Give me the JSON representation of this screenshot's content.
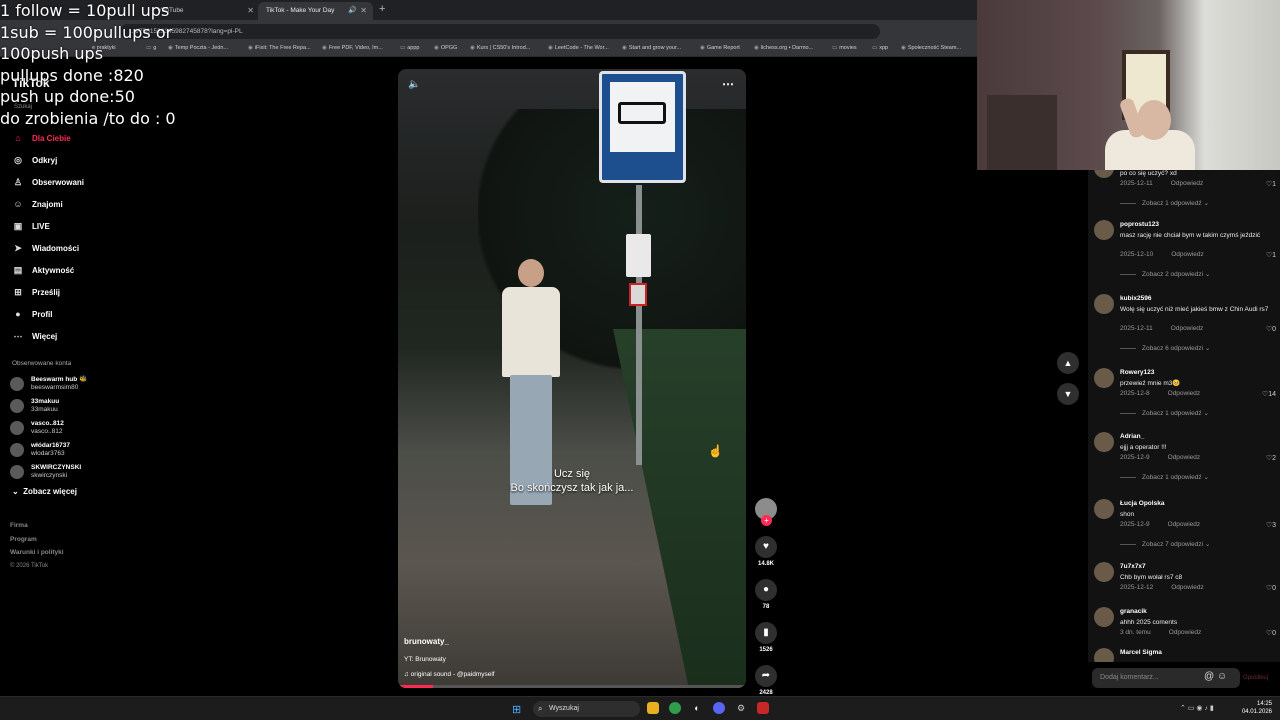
{
  "browser": {
    "tabs": [
      {
        "label": "YouTube",
        "active": false
      },
      {
        "label": "TikTok - Make Your Day",
        "active": true
      }
    ],
    "url": "...t/7581529345982745878?lang=pl-PL",
    "bookmarks": [
      "e praktyki",
      "g",
      "Temp Poczta - Jedn...",
      "iFixit: The Free Repa...",
      "Free PDF, Video, Im...",
      "appp",
      "OPGG",
      "Kurs | CS50's Introd...",
      "LeetCode - The Wor...",
      "Start and grow your...",
      "Game Report",
      "lichess.org • Darmo...",
      "movies",
      "xpp",
      "Społeczność Steam..."
    ]
  },
  "overlay_lines": [
    "1 follow = 10pull ups",
    "1sub = 100pullups or",
    "100push ups",
    "pullups done :820",
    "push up done:50",
    "do zrobienia /to do : 0"
  ],
  "sidebar": {
    "logo": "TikTok",
    "search_hint": "Szukaj",
    "nav": [
      {
        "icon": "home-icon",
        "glyph": "⌂",
        "label": "Dla Ciebie",
        "active": true
      },
      {
        "icon": "compass-icon",
        "glyph": "◎",
        "label": "Odkryj"
      },
      {
        "icon": "user-icon",
        "glyph": "♙",
        "label": "Obserwowani"
      },
      {
        "icon": "friends-icon",
        "glyph": "☺",
        "label": "Znajomi"
      },
      {
        "icon": "live-icon",
        "glyph": "▣",
        "label": "LIVE"
      },
      {
        "icon": "send-icon",
        "glyph": "➤",
        "label": "Wiadomości"
      },
      {
        "icon": "activity-icon",
        "glyph": "▤",
        "label": "Aktywność"
      },
      {
        "icon": "upload-icon",
        "glyph": "⊞",
        "label": "Prześlij"
      },
      {
        "icon": "profile-icon",
        "glyph": "●",
        "label": "Profil"
      },
      {
        "icon": "more-icon",
        "glyph": "⋯",
        "label": "Więcej"
      }
    ],
    "following_title": "Obserwowane konta",
    "accounts": [
      {
        "name": "Beeswarm hub 🐝",
        "user": "beeswarmsim80"
      },
      {
        "name": "33makuu",
        "user": "33makuu"
      },
      {
        "name": "vasco..812",
        "user": "vasco..812"
      },
      {
        "name": "włódar16737",
        "user": "wlodar3763"
      },
      {
        "name": "SKWIRCZYNSKI",
        "user": "skwirczynski"
      }
    ],
    "see_more": "Zobacz więcej",
    "footer": [
      "Firma",
      "Program",
      "Warunki i polityki"
    ],
    "copyright": "© 2026 TikTok"
  },
  "video": {
    "caption_line1": "Ucz się",
    "caption_line2": "Bo skończysz tak jak ja...",
    "author": "brunowaty_",
    "description": "YT: Brunowaty",
    "sound": "♫  original sound - @paidmyself",
    "progress": 0.1,
    "actions": {
      "likes": "14.8K",
      "comments": "78",
      "saves": "1526",
      "shares": "2428"
    }
  },
  "comments": [
    {
      "user": "",
      "text": "po co się uczyć? xd",
      "date": "2025-12-11",
      "reply": "Odpowiedz",
      "likes": "1",
      "replies": "Zobacz 1 odpowiedź"
    },
    {
      "user": "poprostu123",
      "text": "masz rację nie chciał bym w takim czymś jeździć",
      "date": "2025-12-10",
      "reply": "Odpowiedz",
      "likes": "1",
      "replies": "Zobacz 2 odpowiedzi"
    },
    {
      "user": "kubix2596",
      "text": "Wolę się uczyć niż mieć jakieś bmw z Chin Audi rs7",
      "date": "2025-12-11",
      "reply": "Odpowiedz",
      "likes": "0",
      "replies": "Zobacz 6 odpowiedzi"
    },
    {
      "user": "Rowery123",
      "text": "przewieź mnie m3🥺",
      "date": "2025-12-8",
      "reply": "Odpowiedz",
      "likes": "14",
      "replies": "Zobacz 1 odpowiedź"
    },
    {
      "user": "Adrian_",
      "text": "ejjj a operator !!!",
      "date": "2025-12-9",
      "reply": "Odpowiedz",
      "likes": "2",
      "replies": "Zobacz 1 odpowiedź"
    },
    {
      "user": "Łucja Opolska",
      "text": "shon",
      "date": "2025-12-9",
      "reply": "Odpowiedz",
      "likes": "3",
      "replies": "Zobacz 7 odpowiedzi"
    },
    {
      "user": "7u7x7x7",
      "text": "Chb bym wołał rs7 c8",
      "date": "2025-12-12",
      "reply": "Odpowiedz",
      "likes": "0",
      "replies": ""
    },
    {
      "user": "granacik",
      "text": "ahhh 2025 coments",
      "date": "3 dn. temu",
      "reply": "Odpowiedz",
      "likes": "0",
      "replies": ""
    },
    {
      "user": "Marcel Sigma",
      "text": "",
      "date": "",
      "reply": "",
      "likes": "",
      "replies": ""
    }
  ],
  "comment_input": {
    "placeholder": "Dodaj komentarz...",
    "post": "Opublikuj"
  },
  "taskbar": {
    "search": "Wyszukaj",
    "time": "14:25",
    "date": "04.01.2026"
  },
  "colors": {
    "accent": "#fe2c55",
    "background": "#000000",
    "panel": "#121212"
  }
}
